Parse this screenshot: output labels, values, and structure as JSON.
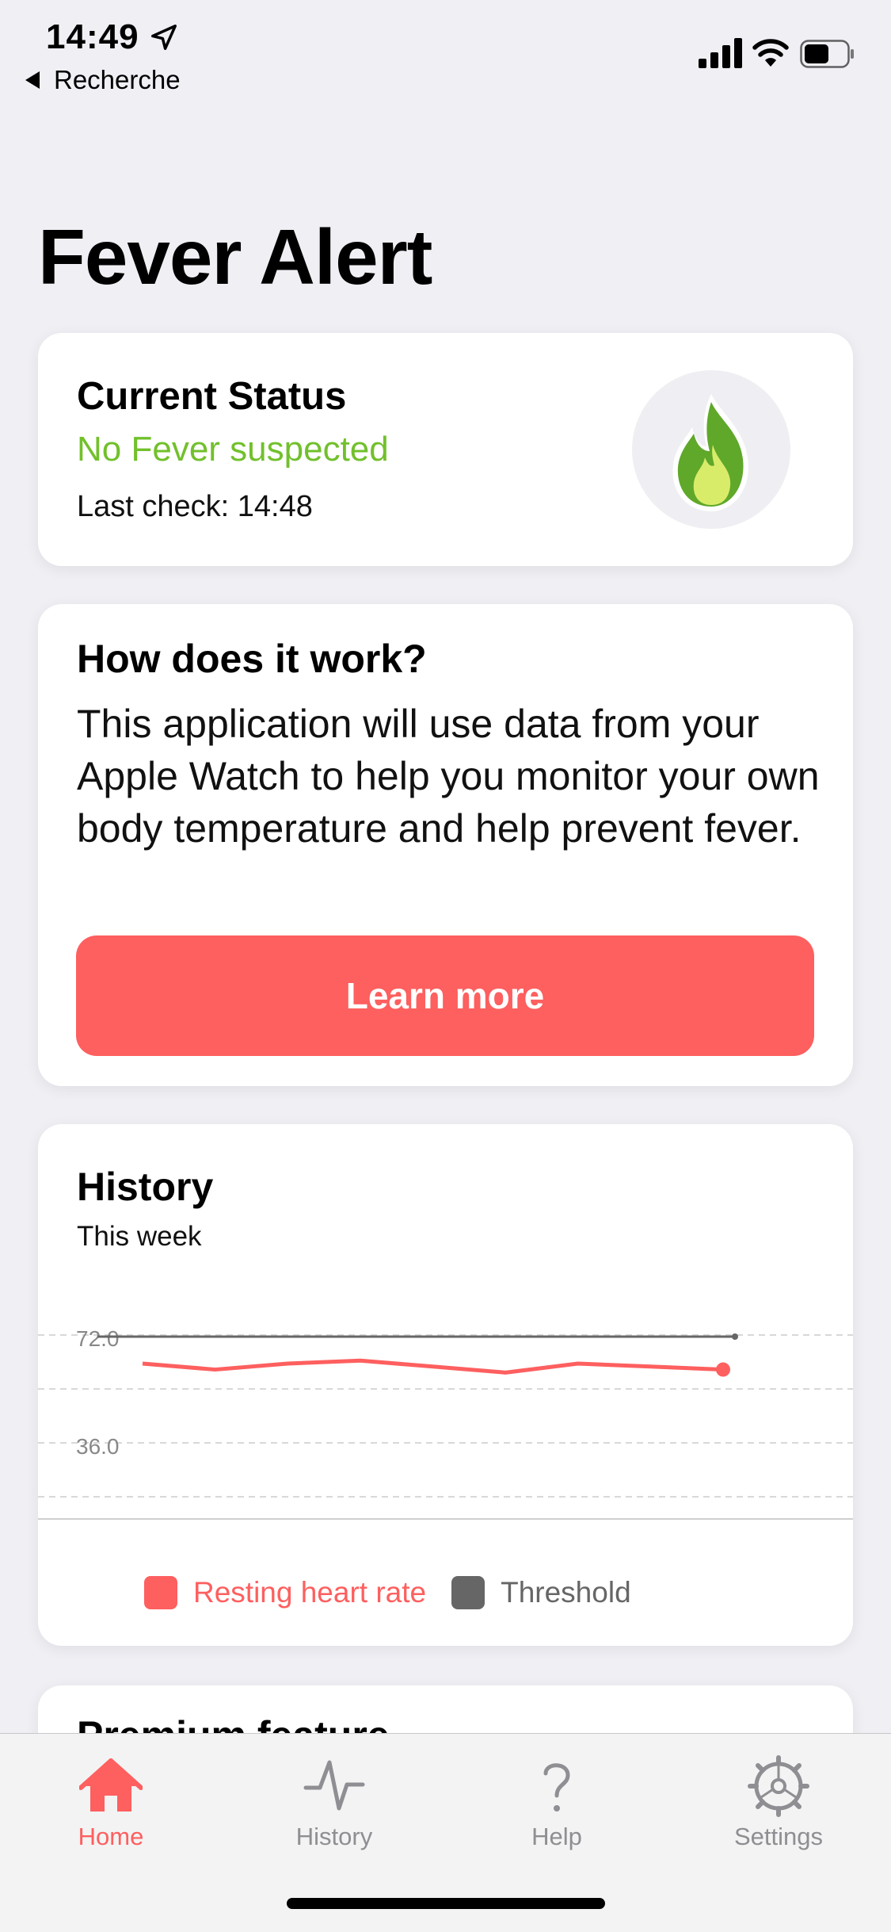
{
  "status_bar": {
    "time": "14:49",
    "back_label": "Recherche"
  },
  "page_title": "Fever Alert",
  "status_card": {
    "title": "Current Status",
    "value": "No Fever suspected",
    "last_check": "Last check: 14:48",
    "icon": "flame-icon",
    "status_color": "#72c02c"
  },
  "how_card": {
    "title": "How does it work?",
    "body": "This application will use data from your Apple Watch to help you monitor your own body temperature and help prevent fever.",
    "button_label": "Learn more",
    "button_color": "#fe5f5f"
  },
  "history_card": {
    "title": "History",
    "subtitle": "This week"
  },
  "chart_data": {
    "type": "line",
    "ytick_labels": [
      "72.0",
      "36.0"
    ],
    "ylim": [
      0,
      90
    ],
    "grid": true,
    "legend_placement": "bottom",
    "series": [
      {
        "name": "Resting heart rate",
        "color": "#fe5f5f",
        "values": [
          63,
          61,
          63,
          64,
          62,
          60,
          63,
          62,
          61
        ]
      },
      {
        "name": "Threshold",
        "color": "#666666",
        "values": [
          72,
          72,
          72,
          72,
          72,
          72,
          72,
          72,
          72
        ]
      }
    ]
  },
  "premium_card": {
    "title": "Premium feature"
  },
  "tab_bar": {
    "active_color": "#fe5f5f",
    "inactive_color": "#8e8e93",
    "tabs": [
      {
        "label": "Home",
        "icon": "home-icon"
      },
      {
        "label": "History",
        "icon": "pulse-icon"
      },
      {
        "label": "Help",
        "icon": "question-icon"
      },
      {
        "label": "Settings",
        "icon": "gear-icon"
      }
    ]
  }
}
